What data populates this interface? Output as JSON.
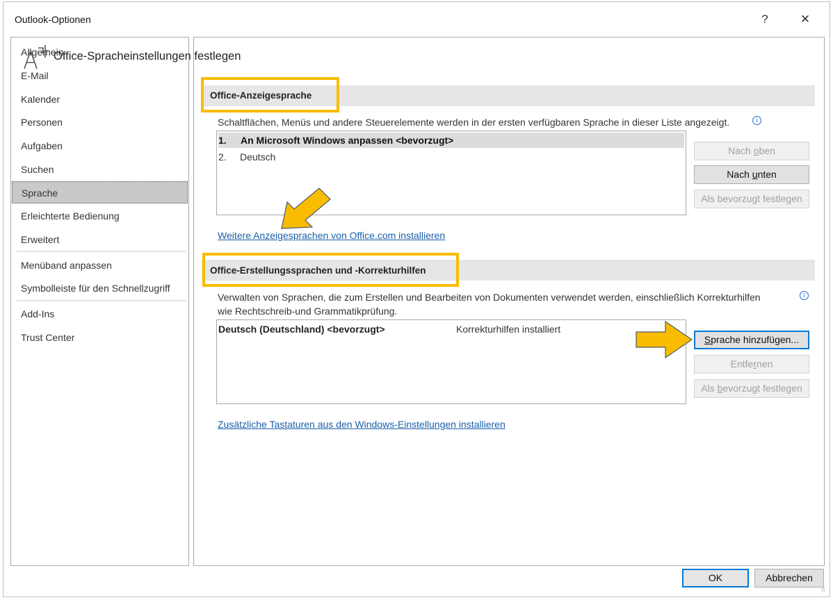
{
  "window": {
    "title": "Outlook-Optionen",
    "help": "?",
    "close": "✕"
  },
  "sidebar": {
    "items": [
      {
        "label": "Allgemein"
      },
      {
        "label": "E-Mail"
      },
      {
        "label": "Kalender"
      },
      {
        "label": "Personen"
      },
      {
        "label": "Aufgaben"
      },
      {
        "label": "Suchen"
      },
      {
        "label": "Sprache",
        "selected": true
      },
      {
        "label": "Erleichterte Bedienung"
      },
      {
        "label": "Erweitert"
      },
      {
        "label": "Menüband anpassen"
      },
      {
        "label": "Symbolleiste für den Schnellzugriff"
      },
      {
        "label": "Add-Ins"
      },
      {
        "label": "Trust Center"
      }
    ]
  },
  "main": {
    "heading": "Office-Spracheinstellungen festlegen",
    "display": {
      "section_title": "Office-Anzeigesprache",
      "description": "Schaltflächen, Menüs und andere Steuerelemente werden in der ersten verfügbaren Sprache in dieser Liste angezeigt.",
      "list": [
        {
          "num": "1.",
          "label": "An Microsoft Windows anpassen <bevorzugt>",
          "selected": true
        },
        {
          "num": "2.",
          "label": "Deutsch"
        }
      ],
      "buttons": {
        "up": {
          "pre": "Nach ",
          "key": "o",
          "post": "ben"
        },
        "down": {
          "pre": "Nach ",
          "key": "u",
          "post": "nten"
        },
        "preferred": "Als bevorzugt festlegen"
      },
      "link": "Weitere Anzeigesprachen von Office.com installieren"
    },
    "authoring": {
      "section_title": "Office-Erstellungssprachen und -Korrekturhilfen",
      "description_line1": "Verwalten von Sprachen, die zum Erstellen und Bearbeiten von Dokumenten verwendet werden, einschließlich Korrekturhilfen",
      "description_line2": "wie Rechtschreib-und Grammatikprüfung.",
      "list": [
        {
          "language": "Deutsch (Deutschland) <bevorzugt>",
          "status": "Korrekturhilfen installiert"
        }
      ],
      "buttons": {
        "add": {
          "key": "S",
          "post": "prache hinzufügen..."
        },
        "remove": {
          "pre": "Entfe",
          "key": "r",
          "post": "nen"
        },
        "preferred": {
          "pre": "Als ",
          "key": "b",
          "post": "evorzugt festlegen"
        }
      },
      "link": "Zusätzliche Tastaturen aus den Windows-Einstellungen installieren"
    }
  },
  "footer": {
    "ok": "OK",
    "cancel": "Abbrechen"
  },
  "colors": {
    "highlight": "#f9bc00",
    "arrow": "#f9bc00",
    "link": "#1a5fa8"
  }
}
